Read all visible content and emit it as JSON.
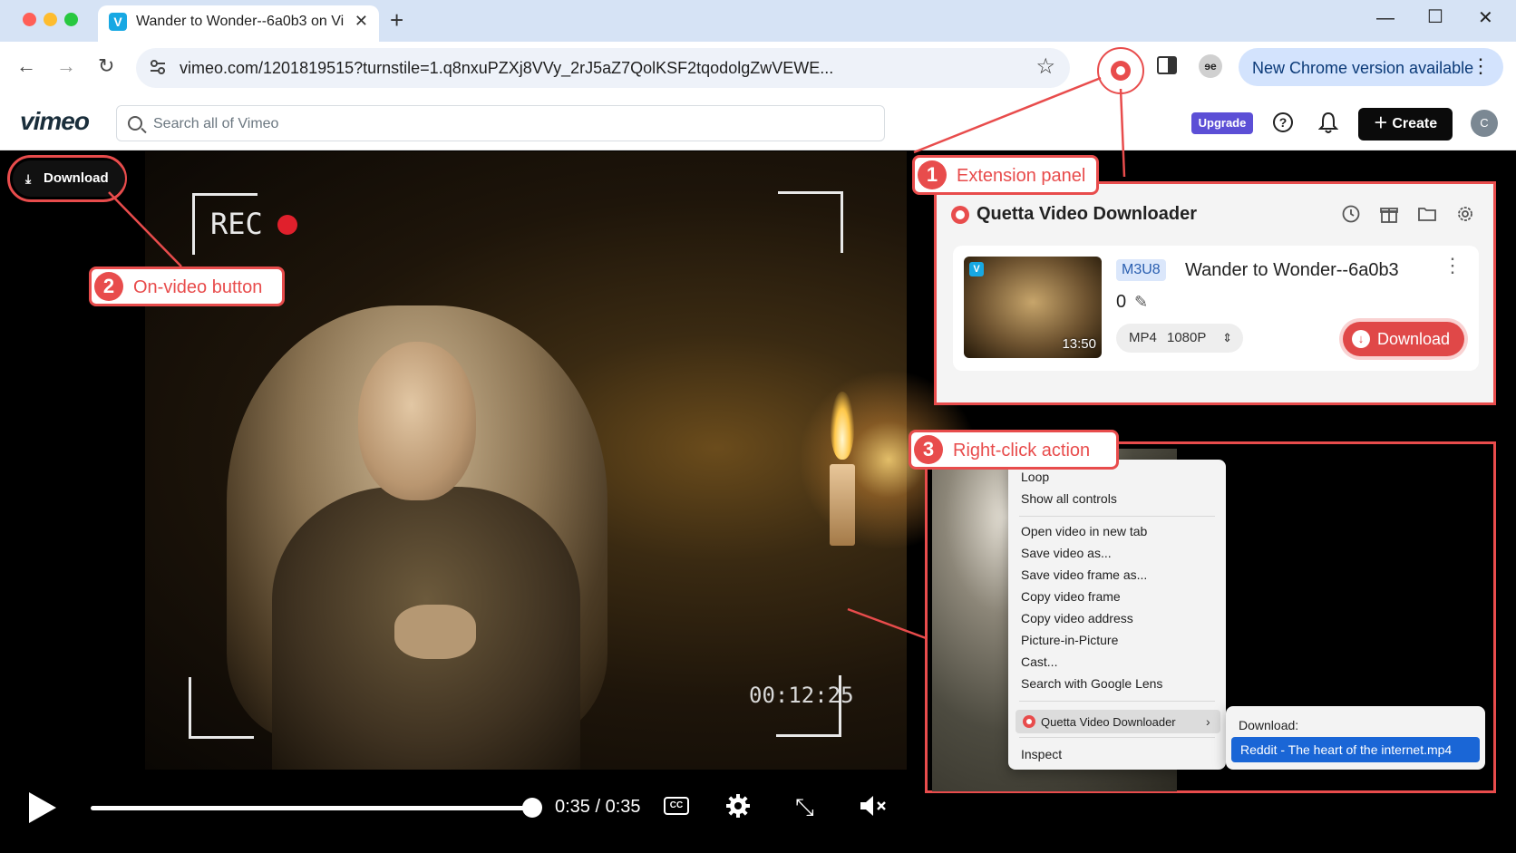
{
  "browser": {
    "tab_title": "Wander to Wonder--6a0b3 on Vi",
    "tab_favicon": "V",
    "url": "vimeo.com/1201819515?turnstile=1.q8nxuPZXj8VVy_2rJ5aZ7QolKSF2tqodolgZwVEWE...",
    "update_text": "New Chrome version available",
    "profile_initials": "ɘe"
  },
  "vimeo": {
    "logo": "vimeo",
    "search_placeholder": "Search all of Vimeo",
    "upgrade_label": "Upgrade",
    "help_glyph": "?",
    "create_label": "Create",
    "avatar_initial": "C"
  },
  "video": {
    "rec_label": "REC",
    "timestamp": "00:12:25",
    "onvideo_download_label": "Download",
    "time_display": "0:35 / 0:35",
    "progress": 1.0,
    "cc_label": "CC"
  },
  "annotations": [
    {
      "num": "1",
      "label": "Extension panel"
    },
    {
      "num": "2",
      "label": "On-video button"
    },
    {
      "num": "3",
      "label": "Right-click action"
    }
  ],
  "extension": {
    "title": "Quetta Video Downloader",
    "header_icons": [
      "history-icon",
      "gift-icon",
      "folder-icon",
      "settings-icon"
    ],
    "item": {
      "badge": "M3U8",
      "title": "Wander to Wonder--6a0b3",
      "count": "0",
      "format": "MP4",
      "quality": "1080P",
      "duration": "13:50",
      "thumb_badge": "V",
      "download_label": "Download"
    }
  },
  "context_menu": {
    "items": [
      "Loop",
      "Show all controls",
      "Open video in new tab",
      "Save video as...",
      "Save video frame as...",
      "Copy video frame",
      "Copy video address",
      "Picture-in-Picture",
      "Cast...",
      "Search with Google Lens",
      "Quetta Video Downloader",
      "Inspect"
    ],
    "submenu_header": "Download:",
    "submenu_item": "Reddit - The heart of the internet.mp4"
  },
  "colors": {
    "annotation_red": "#e84c4c",
    "vimeo_upgrade": "#5c4fd6",
    "chrome_tabstrip": "#d6e3f5",
    "submenu_highlight": "#1a66d6"
  }
}
